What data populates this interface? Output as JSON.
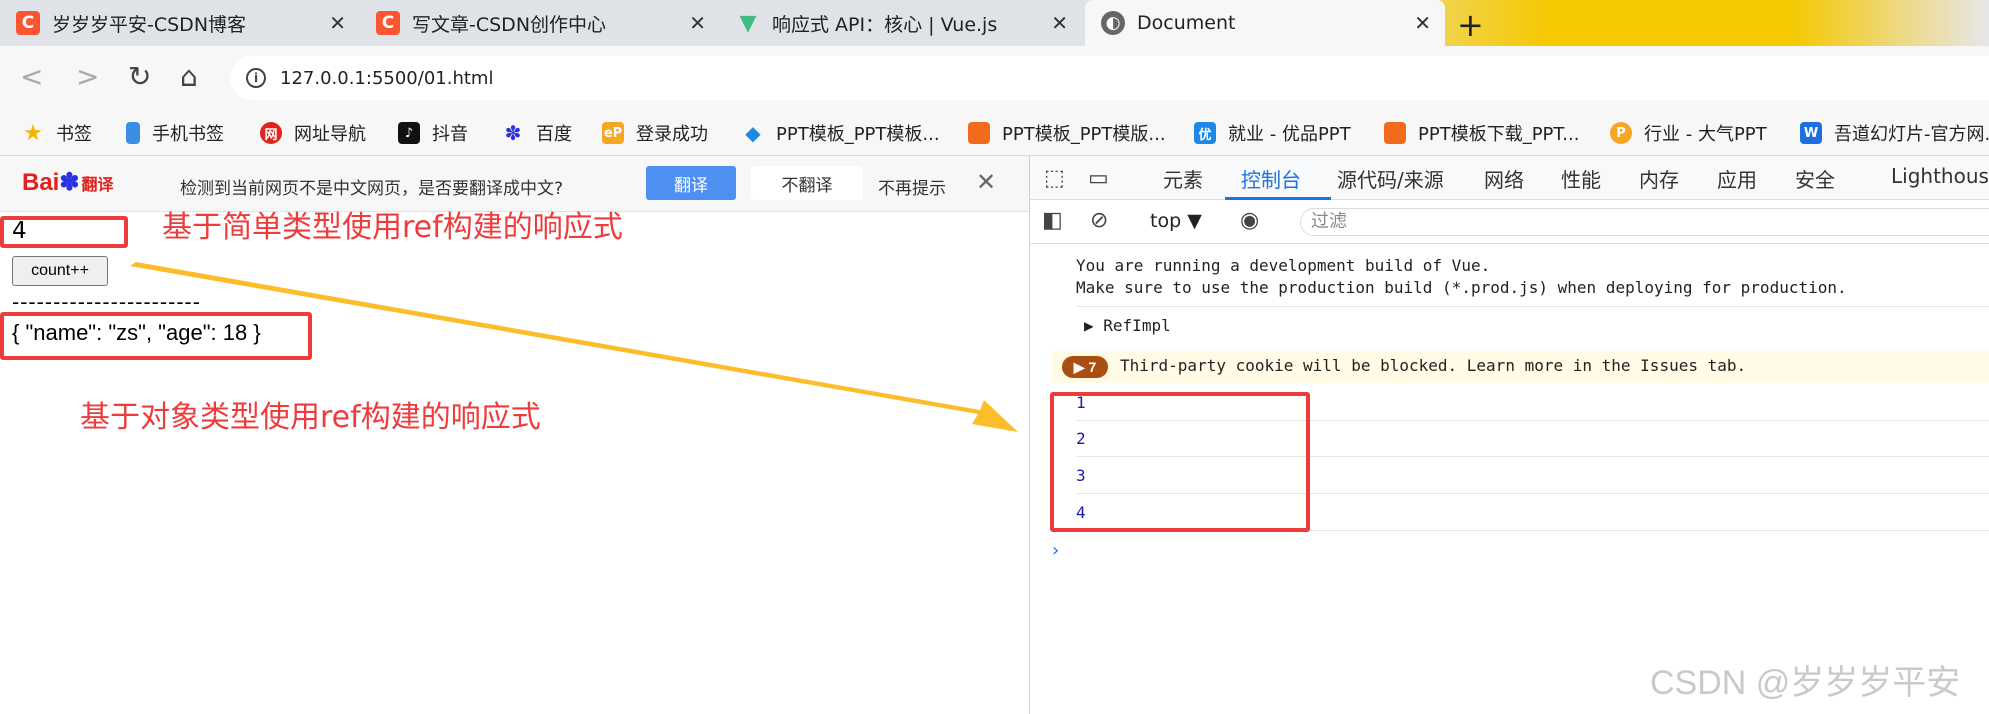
{
  "tabs": [
    {
      "title": "岁岁岁平安-CSDN博客",
      "icon": "csdn-icon",
      "color": "#fc5531"
    },
    {
      "title": "写文章-CSDN创作中心",
      "icon": "csdn-icon",
      "color": "#fc5531"
    },
    {
      "title": "响应式 API：核心 | Vue.js",
      "icon": "vue-icon",
      "color": "#42b883"
    },
    {
      "title": "Document",
      "icon": "globe-icon",
      "color": "#555555"
    }
  ],
  "address": {
    "url": "127.0.0.1:5500/01.html"
  },
  "bookmarks": [
    {
      "label": "书签",
      "icon": "star-icon",
      "color": "#f5b400"
    },
    {
      "label": "手机书签",
      "icon": "phone-icon",
      "color": "#3a8ee6"
    },
    {
      "label": "网址导航",
      "icon": "nav-icon",
      "color": "#e2231a"
    },
    {
      "label": "抖音",
      "icon": "douyin-icon",
      "color": "#111111"
    },
    {
      "label": "百度",
      "icon": "baidu-icon",
      "color": "#2932e1"
    },
    {
      "label": "登录成功",
      "icon": "ep-icon",
      "color": "#f5a623"
    },
    {
      "label": "PPT模板_PPT模板...",
      "icon": "ppt-icon",
      "color": "#1e88e5"
    },
    {
      "label": "PPT模板_PPT模版...",
      "icon": "ppt-icon",
      "color": "#f26b1d"
    },
    {
      "label": "就业 - 优品PPT",
      "icon": "youpin-icon",
      "color": "#1e88e5"
    },
    {
      "label": "PPT模板下载_PPT...",
      "icon": "ppt-icon",
      "color": "#f26b1d"
    },
    {
      "label": "行业 - 大气PPT",
      "icon": "p-icon",
      "color": "#f5a623"
    },
    {
      "label": "吾道幻灯片-官方网...",
      "icon": "wudao-icon",
      "color": "#1e6fe0"
    }
  ],
  "translate_bar": {
    "logo_text": "Bai",
    "logo_suffix": "翻译",
    "message": "检测到当前网页不是中文网页，是否要翻译成中文?",
    "translate": "翻译",
    "no_translate": "不翻译",
    "no_show": "不再提示"
  },
  "page": {
    "count": "4",
    "button": "count++",
    "divider": "-----------------------",
    "object": "{ \"name\": \"zs\", \"age\": 18 }"
  },
  "annotations": {
    "simple": "基于简单类型使用ref构建的响应式",
    "object": "基于对象类型使用ref构建的响应式"
  },
  "devtools": {
    "tabs": [
      "元素",
      "控制台",
      "源代码/来源",
      "网络",
      "性能",
      "内存",
      "应用",
      "安全",
      "Lighthouse"
    ],
    "context": "top",
    "filter_placeholder": "过滤",
    "messages": {
      "vue_line1": "You are running a development build of Vue.",
      "vue_line2": "Make sure to use the production build (*.prod.js) when deploying for production.",
      "refimpl": "RefImpl",
      "warn_count": "7",
      "warn_text": "Third-party cookie will be blocked. Learn more in the Issues tab."
    },
    "logs": [
      "1",
      "2",
      "3",
      "4"
    ]
  },
  "watermark": "CSDN @岁岁岁平安",
  "colors": {
    "annotation": "#ee3b3b",
    "arrow": "#fbbd2a",
    "devtools_accent": "#1a73e8"
  }
}
